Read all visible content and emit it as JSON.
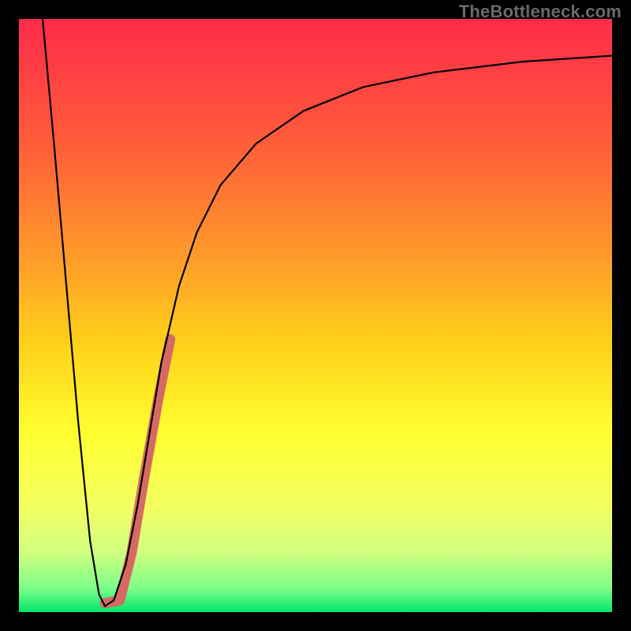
{
  "watermark": "TheBottleneck.com",
  "chart_data": {
    "type": "line",
    "title": "",
    "xlabel": "",
    "ylabel": "",
    "xlim": [
      0,
      100
    ],
    "ylim": [
      0,
      100
    ],
    "grid": false,
    "legend": false,
    "background_gradient": {
      "stops": [
        {
          "offset": 0.0,
          "color": "#ff2b4a"
        },
        {
          "offset": 0.2,
          "color": "#ff5a3a"
        },
        {
          "offset": 0.4,
          "color": "#ff9a2a"
        },
        {
          "offset": 0.55,
          "color": "#ffd21a"
        },
        {
          "offset": 0.7,
          "color": "#ffff30"
        },
        {
          "offset": 0.82,
          "color": "#f4ff60"
        },
        {
          "offset": 0.9,
          "color": "#d0ff80"
        },
        {
          "offset": 0.96,
          "color": "#7dff8a"
        },
        {
          "offset": 1.0,
          "color": "#00e56a"
        }
      ]
    },
    "series": [
      {
        "name": "curve",
        "color": "#000000",
        "stroke_width": 2.2,
        "points": [
          {
            "x": 4.0,
            "y": 100.0
          },
          {
            "x": 6.0,
            "y": 78.0
          },
          {
            "x": 8.0,
            "y": 55.0
          },
          {
            "x": 10.0,
            "y": 32.0
          },
          {
            "x": 12.0,
            "y": 12.0
          },
          {
            "x": 13.5,
            "y": 3.0
          },
          {
            "x": 14.5,
            "y": 1.0
          },
          {
            "x": 16.0,
            "y": 2.0
          },
          {
            "x": 18.0,
            "y": 8.0
          },
          {
            "x": 20.0,
            "y": 18.0
          },
          {
            "x": 22.0,
            "y": 30.0
          },
          {
            "x": 24.0,
            "y": 42.0
          },
          {
            "x": 27.0,
            "y": 55.0
          },
          {
            "x": 30.0,
            "y": 64.0
          },
          {
            "x": 34.0,
            "y": 72.0
          },
          {
            "x": 40.0,
            "y": 79.0
          },
          {
            "x": 48.0,
            "y": 84.5
          },
          {
            "x": 58.0,
            "y": 88.5
          },
          {
            "x": 70.0,
            "y": 91.0
          },
          {
            "x": 85.0,
            "y": 92.8
          },
          {
            "x": 100.0,
            "y": 93.8
          }
        ]
      },
      {
        "name": "highlight-segment",
        "color": "#d66a63",
        "stroke_width": 13,
        "linecap": "round",
        "points": [
          {
            "x": 14.5,
            "y": 1.5
          },
          {
            "x": 17.0,
            "y": 2.0
          },
          {
            "x": 19.0,
            "y": 10.0
          },
          {
            "x": 21.0,
            "y": 22.0
          },
          {
            "x": 23.5,
            "y": 36.0
          },
          {
            "x": 25.5,
            "y": 46.0
          }
        ]
      }
    ]
  }
}
